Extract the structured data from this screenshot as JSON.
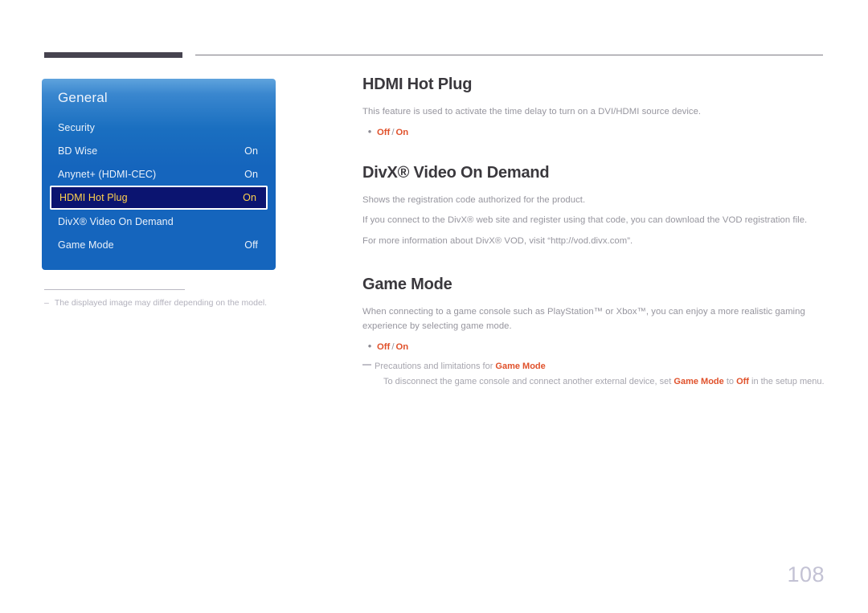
{
  "page": {
    "number": "108"
  },
  "osd": {
    "title": "General",
    "rows": [
      {
        "label": "Security",
        "value": "",
        "selected": false
      },
      {
        "label": "BD Wise",
        "value": "On",
        "selected": false
      },
      {
        "label": "Anynet+ (HDMI-CEC)",
        "value": "On",
        "selected": false
      },
      {
        "label": "HDMI Hot Plug",
        "value": "On",
        "selected": true
      },
      {
        "label": "DivX® Video On Demand",
        "value": "",
        "selected": false
      },
      {
        "label": "Game Mode",
        "value": "Off",
        "selected": false
      }
    ]
  },
  "figure_note": {
    "dash": "–",
    "text": "The displayed image may differ depending on the model."
  },
  "sections": [
    {
      "title": "HDMI Hot Plug",
      "paragraphs": [
        "This feature is used to activate the time delay to turn on a DVI/HDMI source device."
      ],
      "options": {
        "bullet": "•",
        "first": "Off",
        "sep": "/",
        "second": "On"
      }
    },
    {
      "title": "DivX® Video On Demand",
      "paragraphs": [
        "Shows the registration code authorized for the product.",
        "If you connect to the DivX® web site and register using that code, you can download the VOD registration file.",
        "For more information about DivX® VOD, visit “http://vod.divx.com”."
      ]
    },
    {
      "title": "Game Mode",
      "paragraphs": [
        "When connecting to a game console such as PlayStation™ or Xbox™, you can enjoy a more realistic gaming experience by selecting game mode."
      ],
      "options": {
        "bullet": "•",
        "first": "Off",
        "sep": "/",
        "second": "On"
      }
    }
  ],
  "precaution": {
    "head_prefix": "Precautions and limitations for ",
    "head_highlight": "Game Mode",
    "body_part1": "To disconnect the game console and connect another external device, set ",
    "body_hl1": "Game Mode",
    "body_part2": " to ",
    "body_hl2": "Off",
    "body_part3": " in the setup menu."
  },
  "colors": {
    "accent_orange": "#e0512b",
    "osd_blue": "#1565bd",
    "osd_selected_bg": "#0b1470",
    "osd_selected_text": "#ffd24d",
    "heading": "#3a383d",
    "body_text": "#96959e",
    "page_number": "#c3c2d4"
  }
}
